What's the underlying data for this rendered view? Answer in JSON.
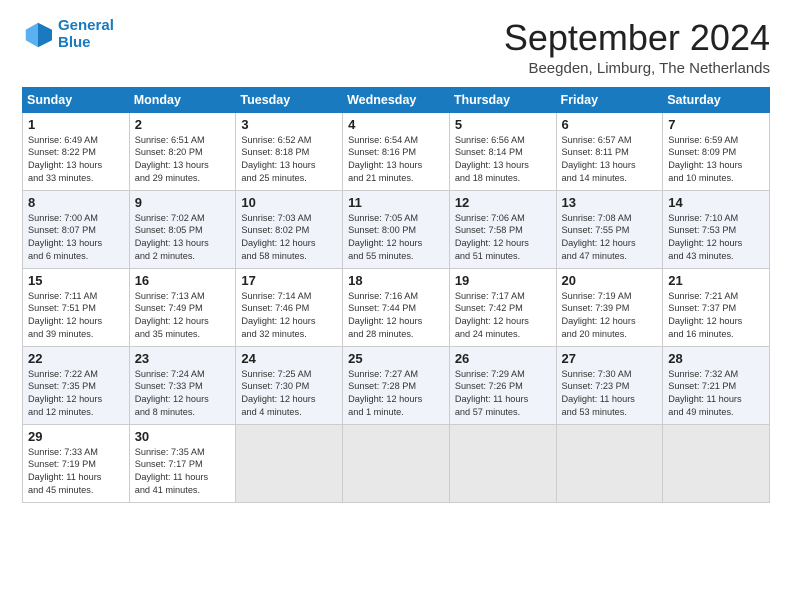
{
  "logo": {
    "line1": "General",
    "line2": "Blue"
  },
  "title": "September 2024",
  "location": "Beegden, Limburg, The Netherlands",
  "days_of_week": [
    "Sunday",
    "Monday",
    "Tuesday",
    "Wednesday",
    "Thursday",
    "Friday",
    "Saturday"
  ],
  "weeks": [
    [
      {
        "day": "1",
        "text": "Sunrise: 6:49 AM\nSunset: 8:22 PM\nDaylight: 13 hours\nand 33 minutes."
      },
      {
        "day": "2",
        "text": "Sunrise: 6:51 AM\nSunset: 8:20 PM\nDaylight: 13 hours\nand 29 minutes."
      },
      {
        "day": "3",
        "text": "Sunrise: 6:52 AM\nSunset: 8:18 PM\nDaylight: 13 hours\nand 25 minutes."
      },
      {
        "day": "4",
        "text": "Sunrise: 6:54 AM\nSunset: 8:16 PM\nDaylight: 13 hours\nand 21 minutes."
      },
      {
        "day": "5",
        "text": "Sunrise: 6:56 AM\nSunset: 8:14 PM\nDaylight: 13 hours\nand 18 minutes."
      },
      {
        "day": "6",
        "text": "Sunrise: 6:57 AM\nSunset: 8:11 PM\nDaylight: 13 hours\nand 14 minutes."
      },
      {
        "day": "7",
        "text": "Sunrise: 6:59 AM\nSunset: 8:09 PM\nDaylight: 13 hours\nand 10 minutes."
      }
    ],
    [
      {
        "day": "8",
        "text": "Sunrise: 7:00 AM\nSunset: 8:07 PM\nDaylight: 13 hours\nand 6 minutes."
      },
      {
        "day": "9",
        "text": "Sunrise: 7:02 AM\nSunset: 8:05 PM\nDaylight: 13 hours\nand 2 minutes."
      },
      {
        "day": "10",
        "text": "Sunrise: 7:03 AM\nSunset: 8:02 PM\nDaylight: 12 hours\nand 58 minutes."
      },
      {
        "day": "11",
        "text": "Sunrise: 7:05 AM\nSunset: 8:00 PM\nDaylight: 12 hours\nand 55 minutes."
      },
      {
        "day": "12",
        "text": "Sunrise: 7:06 AM\nSunset: 7:58 PM\nDaylight: 12 hours\nand 51 minutes."
      },
      {
        "day": "13",
        "text": "Sunrise: 7:08 AM\nSunset: 7:55 PM\nDaylight: 12 hours\nand 47 minutes."
      },
      {
        "day": "14",
        "text": "Sunrise: 7:10 AM\nSunset: 7:53 PM\nDaylight: 12 hours\nand 43 minutes."
      }
    ],
    [
      {
        "day": "15",
        "text": "Sunrise: 7:11 AM\nSunset: 7:51 PM\nDaylight: 12 hours\nand 39 minutes."
      },
      {
        "day": "16",
        "text": "Sunrise: 7:13 AM\nSunset: 7:49 PM\nDaylight: 12 hours\nand 35 minutes."
      },
      {
        "day": "17",
        "text": "Sunrise: 7:14 AM\nSunset: 7:46 PM\nDaylight: 12 hours\nand 32 minutes."
      },
      {
        "day": "18",
        "text": "Sunrise: 7:16 AM\nSunset: 7:44 PM\nDaylight: 12 hours\nand 28 minutes."
      },
      {
        "day": "19",
        "text": "Sunrise: 7:17 AM\nSunset: 7:42 PM\nDaylight: 12 hours\nand 24 minutes."
      },
      {
        "day": "20",
        "text": "Sunrise: 7:19 AM\nSunset: 7:39 PM\nDaylight: 12 hours\nand 20 minutes."
      },
      {
        "day": "21",
        "text": "Sunrise: 7:21 AM\nSunset: 7:37 PM\nDaylight: 12 hours\nand 16 minutes."
      }
    ],
    [
      {
        "day": "22",
        "text": "Sunrise: 7:22 AM\nSunset: 7:35 PM\nDaylight: 12 hours\nand 12 minutes."
      },
      {
        "day": "23",
        "text": "Sunrise: 7:24 AM\nSunset: 7:33 PM\nDaylight: 12 hours\nand 8 minutes."
      },
      {
        "day": "24",
        "text": "Sunrise: 7:25 AM\nSunset: 7:30 PM\nDaylight: 12 hours\nand 4 minutes."
      },
      {
        "day": "25",
        "text": "Sunrise: 7:27 AM\nSunset: 7:28 PM\nDaylight: 12 hours\nand 1 minute."
      },
      {
        "day": "26",
        "text": "Sunrise: 7:29 AM\nSunset: 7:26 PM\nDaylight: 11 hours\nand 57 minutes."
      },
      {
        "day": "27",
        "text": "Sunrise: 7:30 AM\nSunset: 7:23 PM\nDaylight: 11 hours\nand 53 minutes."
      },
      {
        "day": "28",
        "text": "Sunrise: 7:32 AM\nSunset: 7:21 PM\nDaylight: 11 hours\nand 49 minutes."
      }
    ],
    [
      {
        "day": "29",
        "text": "Sunrise: 7:33 AM\nSunset: 7:19 PM\nDaylight: 11 hours\nand 45 minutes."
      },
      {
        "day": "30",
        "text": "Sunrise: 7:35 AM\nSunset: 7:17 PM\nDaylight: 11 hours\nand 41 minutes."
      },
      {
        "day": "",
        "text": ""
      },
      {
        "day": "",
        "text": ""
      },
      {
        "day": "",
        "text": ""
      },
      {
        "day": "",
        "text": ""
      },
      {
        "day": "",
        "text": ""
      }
    ]
  ]
}
